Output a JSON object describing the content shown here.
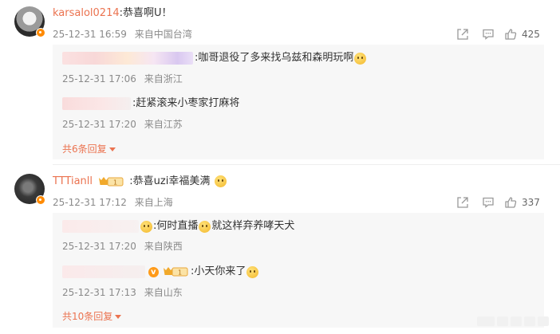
{
  "comments": [
    {
      "username": "karsalol0214",
      "text": ":恭喜啊U！",
      "time": "25-12-31 16:59",
      "location": "来自中国台湾",
      "likes": "425",
      "replies": [
        {
          "text": ":咖哥退役了多来找乌兹和森明玩啊",
          "time": "25-12-31 17:06",
          "location": "来自浙江"
        },
        {
          "text": ":赶紧滚来小枣家打麻将",
          "time": "25-12-31 17:20",
          "location": "来自江苏"
        }
      ],
      "more_replies": "共6条回复"
    },
    {
      "username": "TTTianll",
      "badge_level": "1",
      "text": ":恭喜uzi幸福美满",
      "time": "25-12-31 17:12",
      "location": "来自上海",
      "likes": "337",
      "replies": [
        {
          "text_a": ":何时直播",
          "text_b": "就这样弃养哮天犬",
          "time": "25-12-31 17:20",
          "location": "来自陕西"
        },
        {
          "badge_level": "1",
          "text": ":小天你来了",
          "time": "25-12-31 17:13",
          "location": "来自山东"
        }
      ],
      "more_replies": "共10条回复"
    }
  ],
  "icons": [
    "share-icon",
    "comment-icon",
    "like-icon",
    "crown-badge-icon",
    "verified-icon",
    "emoji-icon"
  ],
  "colors": {
    "username": "#eb7350",
    "meta": "#8a8a8a",
    "reply_bg": "#f7f7f7",
    "badge": "#ff8a00"
  }
}
